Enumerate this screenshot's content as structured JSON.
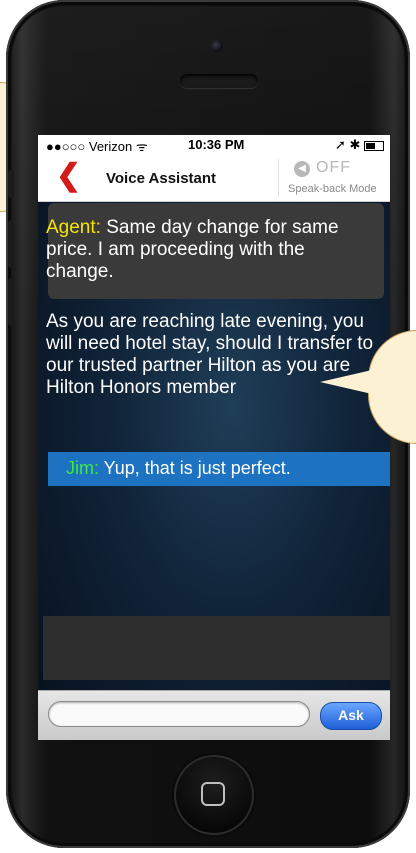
{
  "status_bar": {
    "carrier": "●●○○○ Verizon ᯤ",
    "time": "10:36 PM",
    "right_icons": "➚ ✱"
  },
  "nav": {
    "back_icon": "❮",
    "title": "Voice Assistant",
    "speak_back_state": "OFF",
    "speak_back_label": "Speak-back Mode"
  },
  "conversation": {
    "agent_name": "Agent:",
    "agent_message": " Same day change for same price. I am proceeding with the change.",
    "assistant_message": "As you are reaching late evening, you will need hotel stay, should I transfer to our trusted partner Hilton as you are Hilton Honors member",
    "user_name": "Jim:",
    "user_message": " Yup, that is just perfect."
  },
  "ask_bar": {
    "input_value": "",
    "input_placeholder": "",
    "button_label": "Ask"
  },
  "icons": {
    "back": "chevron-left-icon",
    "speaker": "speaker-icon",
    "home": "home-button-icon"
  },
  "colors": {
    "agent_name": "#f4e400",
    "user_name": "#3ce93c",
    "user_bar": "#1d73c2",
    "back_accent": "#d21c1c",
    "callout": "#fdf1d4"
  }
}
